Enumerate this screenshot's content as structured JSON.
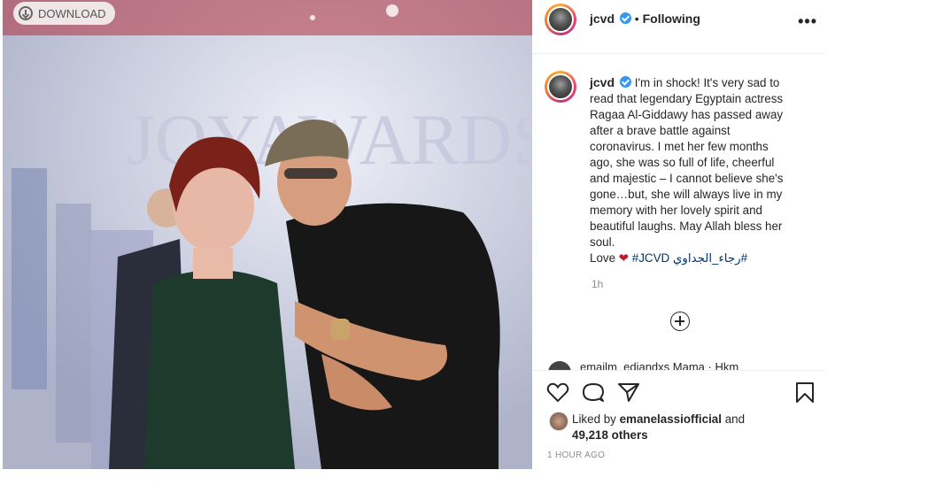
{
  "download": {
    "label": "DOWNLOAD"
  },
  "header": {
    "username": "jcvd",
    "separator": "•",
    "follow_status": "Following",
    "more": "•••"
  },
  "caption": {
    "username": "jcvd",
    "text": "I'm in shock! It's very sad to read that legendary Egyptain actress Ragaa Al-Giddawy has passed away after a brave battle against coronavirus. I met her few months ago, she was so full of life, cheerful and majestic – I cannot believe she's gone…but, she will always live in my memory with her lovely spirit and beautiful laughs. May Allah bless her soul.",
    "love_word": "Love",
    "hashtag1": "#JCVD",
    "hashtag2": "#رجاء_الجداوي",
    "time": "1h"
  },
  "partial_comment": {
    "text": "emailm_ediandxs Mama · Hkm"
  },
  "likes": {
    "prefix": "Liked by",
    "user": "emanelassiofficial",
    "connector": "and",
    "count": "49,218 others"
  },
  "posted_ago": "1 HOUR AGO",
  "photo": {
    "banner_text": "JOYAWARDS"
  }
}
